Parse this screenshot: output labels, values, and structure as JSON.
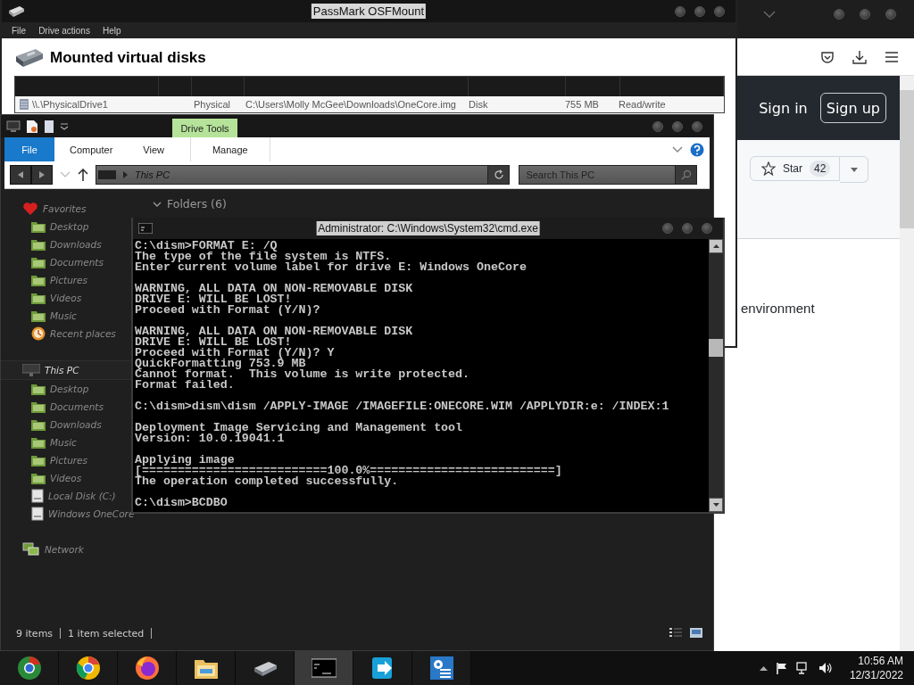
{
  "browser": {
    "sign_in": "Sign in",
    "sign_up": "Sign up",
    "star": {
      "label": "Star",
      "count": "42"
    },
    "body_text": "environment"
  },
  "osfmount": {
    "title": "PassMark OSFMount",
    "menu": [
      "File",
      "Drive actions",
      "Help"
    ],
    "heading": "Mounted virtual disks",
    "rows": [
      {
        "cells": [
          "\\\\.\\PhysicalDrive1",
          "Physical",
          "C:\\Users\\Molly McGee\\Downloads\\OneCore.img",
          "Disk",
          "755 MB",
          "Read/write"
        ]
      }
    ]
  },
  "explorer": {
    "contextual_tab": "Drive Tools",
    "tabs": [
      {
        "label": "File",
        "kind": "file"
      },
      {
        "label": "Computer",
        "kind": "plain"
      },
      {
        "label": "View",
        "kind": "plain"
      },
      {
        "label": "Manage",
        "kind": "contextual"
      }
    ],
    "address": "This PC",
    "search_placeholder": "Search This PC",
    "folders_header": "Folders (6)",
    "sidebar": [
      {
        "label": "Favorites",
        "kind": "heart",
        "selected": false,
        "children": [
          {
            "label": "Desktop",
            "kind": "folder",
            "selected": false
          },
          {
            "label": "Downloads",
            "kind": "folder",
            "selected": false
          },
          {
            "label": "Documents",
            "kind": "folder",
            "selected": false
          },
          {
            "label": "Pictures",
            "kind": "folder",
            "selected": false
          },
          {
            "label": "Videos",
            "kind": "folder",
            "selected": false
          },
          {
            "label": "Music",
            "kind": "folder",
            "selected": false
          },
          {
            "label": "Recent places",
            "kind": "recent",
            "selected": false
          }
        ]
      },
      {
        "label": "This PC",
        "kind": "pc",
        "selected": true,
        "children": [
          {
            "label": "Desktop",
            "kind": "folder",
            "selected": false
          },
          {
            "label": "Documents",
            "kind": "folder",
            "selected": false
          },
          {
            "label": "Downloads",
            "kind": "folder",
            "selected": false
          },
          {
            "label": "Music",
            "kind": "folder",
            "selected": false
          },
          {
            "label": "Pictures",
            "kind": "folder",
            "selected": false
          },
          {
            "label": "Videos",
            "kind": "folder",
            "selected": false
          },
          {
            "label": "Local Disk (C:)",
            "kind": "drive",
            "selected": false
          },
          {
            "label": "Windows OneCore",
            "kind": "drive",
            "selected": false
          }
        ]
      },
      {
        "label": "Network",
        "kind": "network",
        "selected": false
      }
    ],
    "status": [
      "9 items",
      "1 item selected"
    ]
  },
  "cmd": {
    "title": "Administrator: C:\\Windows\\System32\\cmd.exe",
    "blocks": [
      [
        "C:\\dism>FORMAT E: /Q",
        "The type of the file system is NTFS.",
        "Enter current volume label for drive E: Windows OneCore"
      ],
      [
        "WARNING, ALL DATA ON NON-REMOVABLE DISK",
        "DRIVE E: WILL BE LOST!",
        "Proceed with Format (Y/N)?"
      ],
      [
        "WARNING, ALL DATA ON NON-REMOVABLE DISK",
        "DRIVE E: WILL BE LOST!",
        "Proceed with Format (Y/N)? Y",
        "QuickFormatting 753.9 MB",
        "Cannot format.  This volume is write protected.",
        "Format failed."
      ],
      [
        "C:\\dism>dism\\dism /APPLY-IMAGE /IMAGEFILE:ONECORE.WIM /APPLYDIR:e: /INDEX:1"
      ],
      [
        "Deployment Image Servicing and Management tool",
        "Version: 10.0.19041.1"
      ],
      [
        "Applying image",
        "[==========================100.0%==========================]",
        "The operation completed successfully."
      ],
      [
        "C:\\dism>BCDBO"
      ]
    ]
  },
  "taskbar": {
    "apps": [
      {
        "kind": "chromium",
        "selected": false
      },
      {
        "kind": "chrome",
        "selected": false
      },
      {
        "kind": "firefox",
        "selected": false
      },
      {
        "kind": "files",
        "selected": false
      },
      {
        "kind": "drive",
        "selected": false
      },
      {
        "kind": "console",
        "selected": true
      },
      {
        "kind": "arrow",
        "selected": false
      },
      {
        "kind": "settings",
        "selected": false
      }
    ],
    "time": "10:56 AM",
    "date": "12/31/2022"
  }
}
